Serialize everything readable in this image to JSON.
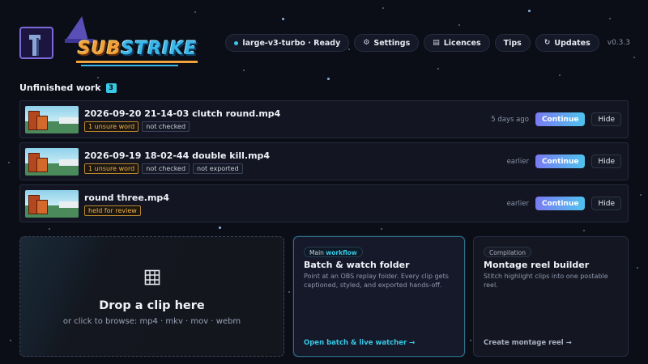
{
  "header": {
    "app_name_part1": "SUB",
    "app_name_part2": "STRIKE",
    "nav": [
      {
        "label": "large-v3-turbo · Ready",
        "icon": "status-dot"
      },
      {
        "label": "Settings",
        "icon": "gear-icon",
        "glyph": "⚙"
      },
      {
        "label": "Licences",
        "icon": "document-icon",
        "glyph": "▤"
      },
      {
        "label": "Tips",
        "icon": "",
        "glyph": ""
      },
      {
        "label": "Updates",
        "icon": "refresh-icon",
        "glyph": "↻"
      }
    ],
    "version": "v0.3.3"
  },
  "unfinished": {
    "title": "Unfinished work",
    "count": "3",
    "items": [
      {
        "name": "2026-09-20 21-14-03 clutch round.mp4",
        "tags": [
          {
            "text": "1 unsure word",
            "warn": true
          },
          {
            "text": "not checked",
            "warn": false
          }
        ],
        "when": "5 days ago",
        "continue": "Continue",
        "hide": "Hide"
      },
      {
        "name": "2026-09-19 18-02-44 double kill.mp4",
        "tags": [
          {
            "text": "1 unsure word",
            "warn": true
          },
          {
            "text": "not checked",
            "warn": false
          },
          {
            "text": "not exported",
            "warn": false
          }
        ],
        "when": "earlier",
        "continue": "Continue",
        "hide": "Hide"
      },
      {
        "name": "round three.mp4",
        "tags": [
          {
            "text": "held for review",
            "warn": true
          }
        ],
        "when": "earlier",
        "continue": "Continue",
        "hide": "Hide"
      }
    ]
  },
  "drop": {
    "title": "Drop a clip here",
    "subtitle": "or click to browse: mp4 · mkv · mov · webm"
  },
  "batch_card": {
    "chip_prefix": "Main",
    "chip_highlight": "workflow",
    "title": "Batch & watch folder",
    "description": "Point at an OBS replay folder. Every clip gets captioned, styled, and exported hands-off.",
    "link": "Open batch & live watcher →"
  },
  "montage_card": {
    "chip": "Compilation",
    "title": "Montage reel builder",
    "description": "Stitch highlight clips into one postable reel.",
    "link": "Create montage reel →"
  },
  "colors": {
    "accent": "#38c9e6",
    "warn": "#f0b24a",
    "continue_start": "#7a7bf2",
    "continue_end": "#4fc3ee"
  }
}
